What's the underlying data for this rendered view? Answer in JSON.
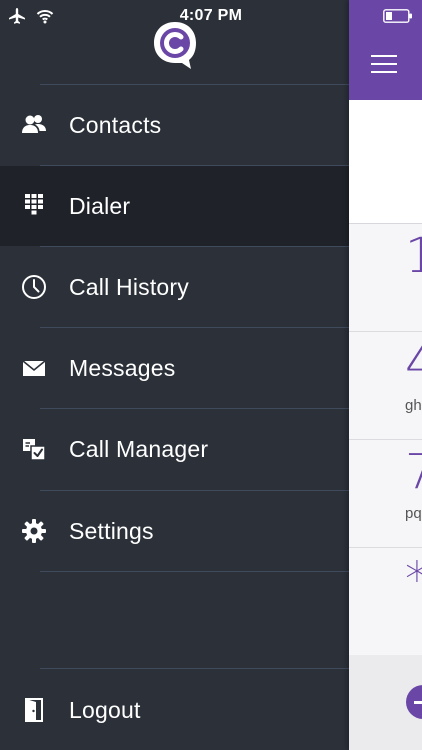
{
  "status_bar": {
    "time": "4:07 PM"
  },
  "menu": {
    "items": [
      {
        "label": "Contacts",
        "icon": "contacts-icon"
      },
      {
        "label": "Dialer",
        "icon": "dialpad-icon",
        "active": true
      },
      {
        "label": "Call History",
        "icon": "clock-icon"
      },
      {
        "label": "Messages",
        "icon": "envelope-icon"
      },
      {
        "label": "Call Manager",
        "icon": "call-manager-icon"
      },
      {
        "label": "Settings",
        "icon": "gear-icon"
      }
    ],
    "logout_label": "Logout"
  },
  "dialer": {
    "keys": [
      {
        "digit": "1",
        "letters": ""
      },
      {
        "digit": "4",
        "letters": "ghi"
      },
      {
        "digit": "7",
        "letters": "pqrs"
      },
      {
        "digit": "*",
        "letters": ""
      }
    ]
  },
  "colors": {
    "drawer_bg": "#2b3039",
    "active_item_bg": "#1f2329",
    "accent": "#6a46a6",
    "divider": "#3f4a5c"
  }
}
